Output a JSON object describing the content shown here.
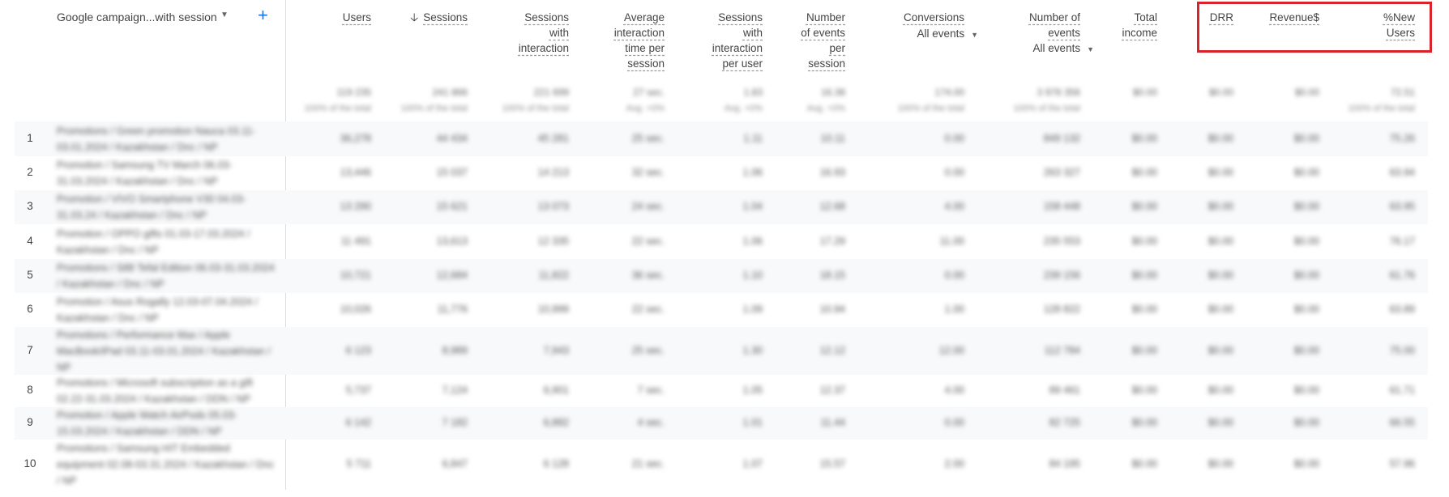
{
  "dimension": {
    "label": "Google campaign...with session"
  },
  "columns": [
    {
      "key": "users",
      "title": "Users",
      "sorted": false,
      "total": "119 235",
      "total_sub": "100% of the total"
    },
    {
      "key": "sessions",
      "title": "Sessions",
      "sorted": true,
      "total": "241 866",
      "total_sub": "100% of the total"
    },
    {
      "key": "sessions_with_interaction",
      "title": "Sessions\nwith\ninteraction",
      "sorted": false,
      "total": "221 699",
      "total_sub": "100% of the total"
    },
    {
      "key": "avg_interaction_time",
      "title": "Average\ninteraction\ntime per\nsession",
      "sorted": false,
      "total": "27 sec.",
      "total_sub": "Avg. +0%"
    },
    {
      "key": "sessions_with_interaction_per_user",
      "title": "Sessions\nwith\ninteraction\nper user",
      "sorted": false,
      "total": "1.83",
      "total_sub": "Avg. +0%"
    },
    {
      "key": "events_per_session",
      "title": "Number\nof events\nper\nsession",
      "sorted": false,
      "total": "16.38",
      "total_sub": "Avg. +0%"
    },
    {
      "key": "conversions",
      "title": "Conversions",
      "sorted": false,
      "select": "All events",
      "total": "174.00",
      "total_sub": "100% of the total"
    },
    {
      "key": "event_count",
      "title": "Number of\nevents",
      "sorted": false,
      "select": "All events",
      "total": "3 976 356",
      "total_sub": "100% of the total"
    },
    {
      "key": "total_income",
      "title": "Total\nincome",
      "sorted": false,
      "total": "$0.00",
      "total_sub": ""
    },
    {
      "key": "drr",
      "title": "DRR",
      "sorted": false,
      "total": "$0.00",
      "total_sub": ""
    },
    {
      "key": "revenue",
      "title": "Revenue$",
      "sorted": false,
      "total": "$0.00",
      "total_sub": ""
    },
    {
      "key": "new_users",
      "title": "%New\nUsers",
      "sorted": false,
      "total": "72.51",
      "total_sub": "100% of the total"
    }
  ],
  "rows": [
    {
      "num": "1",
      "label": "Promotions / Green promotion Nauca 03.11-03.01.2024 / Kazakhstan / Dnc / NP",
      "values": [
        "36,278",
        "44 434",
        "45 281",
        "25 sec.",
        "1.11",
        "10.11",
        "0.00",
        "849 132",
        "$0.00",
        "$0.00",
        "$0.00",
        "75.26"
      ]
    },
    {
      "num": "2",
      "label": "Promotion / Samsung TV March 06.03-31.03.2024 / Kazakhstan / Dnc / NP",
      "values": [
        "13,446",
        "15 037",
        "14 213",
        "32 sec.",
        "1.06",
        "16.93",
        "0.00",
        "263 327",
        "$0.00",
        "$0.00",
        "$0.00",
        "63.94"
      ]
    },
    {
      "num": "3",
      "label": "Promotion / VIVO Smartphone V30 04.03-31.03.24 / Kazakhstan / Dnc / NP",
      "values": [
        "13 290",
        "15 621",
        "13 073",
        "24 sec.",
        "1.04",
        "12.68",
        "4.00",
        "158 448",
        "$0.00",
        "$0.00",
        "$0.00",
        "63.95"
      ]
    },
    {
      "num": "4",
      "label": "Promotion / OPPO gifts 01.03-17.03.2024 / Kazakhstan / Dnc / NP",
      "values": [
        "11 491",
        "13,613",
        "12 335",
        "22 sec.",
        "1.06",
        "17.29",
        "11.00",
        "235 553",
        "$0.00",
        "$0.00",
        "$0.00",
        "76.17"
      ]
    },
    {
      "num": "5",
      "label": "Promotions / S88 Tefal Edition 06.03-31.03.2024 / Kazakhstan / Dnc / NP",
      "values": [
        "10,721",
        "12,684",
        "11,822",
        "36 sec.",
        "1.10",
        "18.15",
        "0.00",
        "239 156",
        "$0.00",
        "$0.00",
        "$0.00",
        "61.76"
      ]
    },
    {
      "num": "6",
      "label": "Promotion / Asus Rogally 12.03-07.04.2024 / Kazakhstan / Dnc / NP",
      "values": [
        "10,026",
        "11,776",
        "10,999",
        "22 sec.",
        "1.09",
        "10.94",
        "1.00",
        "128 822",
        "$0.00",
        "$0.00",
        "$0.00",
        "63.89"
      ]
    },
    {
      "num": "7",
      "label": "Promotions / Performance Max / Apple MacBook/iPad 03.11-03.01.2024 / Kazakhstan / NP",
      "values": [
        "6 123",
        "8,989",
        "7,943",
        "25 sec.",
        "1.30",
        "12.12",
        "12.00",
        "112 784",
        "$0.00",
        "$0.00",
        "$0.00",
        "75.00"
      ]
    },
    {
      "num": "8",
      "label": "Promotions / Microsoft subscription as a gift 02.22-31.03.2024 / Kazakhstan / DDN / NP",
      "values": [
        "5,737",
        "7,124",
        "6,901",
        "7 sec.",
        "1.05",
        "12.37",
        "4.00",
        "89 461",
        "$0.00",
        "$0.00",
        "$0.00",
        "61.71"
      ]
    },
    {
      "num": "9",
      "label": "Promotion / Apple Watch AirPods 05.03-15.03.2024 / Kazakhstan / DDN / NP",
      "values": [
        "6 142",
        "7 182",
        "6,882",
        "4 sec.",
        "1.01",
        "11.44",
        "0.00",
        "82 725",
        "$0.00",
        "$0.00",
        "$0.00",
        "66.55"
      ]
    },
    {
      "num": "10",
      "label": "Promotions / Samsung HIT Embedded equipment 02.08-03.31.2024 / Kazakhstan / Dnc / NP",
      "values": [
        "5 711",
        "6,847",
        "6 128",
        "21 sec.",
        "1.07",
        "15.57",
        "2.00",
        "84 195",
        "$0.00",
        "$0.00",
        "$0.00",
        "57.96"
      ]
    }
  ]
}
